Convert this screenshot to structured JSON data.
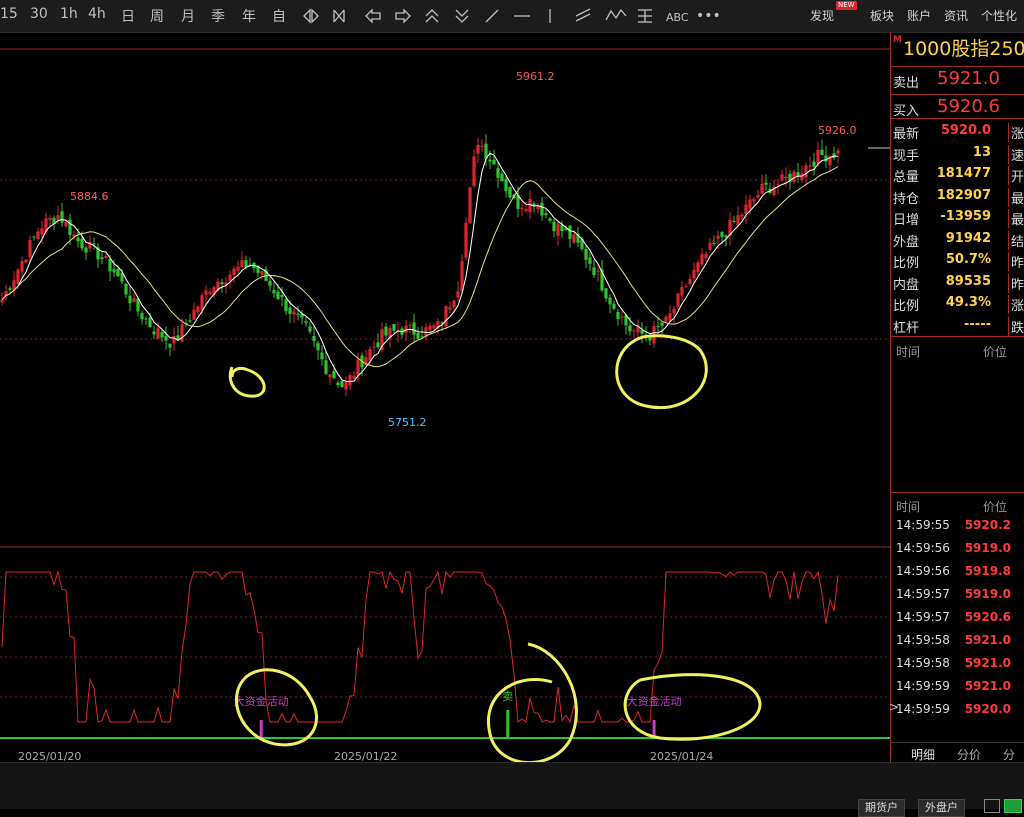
{
  "toolbar": {
    "periods": [
      "15",
      "30",
      "1h",
      "4h",
      "日",
      "周",
      "月",
      "季",
      "年",
      "自"
    ],
    "right_menu": [
      "发现",
      "板块",
      "账户",
      "资讯",
      "个性化"
    ],
    "new_badge": "NEW"
  },
  "contract": {
    "mark": "M",
    "name": "1000股指250"
  },
  "quote": {
    "sell_label": "卖出",
    "sell_value": "5921.0",
    "buy_label": "买入",
    "buy_value": "5920.6",
    "rows": [
      {
        "label": "最新",
        "value": "5920.0",
        "color": "#ff3b3b",
        "extra": "涨跌"
      },
      {
        "label": "现手",
        "value": "13",
        "color": "#ffd24d",
        "extra": "速涨"
      },
      {
        "label": "总量",
        "value": "181477",
        "color": "#ffd24d",
        "extra": "开盘"
      },
      {
        "label": "持仓",
        "value": "182907",
        "color": "#ffd24d",
        "extra": "最高"
      },
      {
        "label": "日增",
        "value": "-13959",
        "color": "#ffd24d",
        "extra": "最低"
      },
      {
        "label": "外盘",
        "value": "91942",
        "color": "#ffd24d",
        "extra": "结算"
      },
      {
        "label": "比例",
        "value": "50.7%",
        "color": "#ffd24d",
        "extra": "昨收"
      },
      {
        "label": "内盘",
        "value": "89535",
        "color": "#ffd24d",
        "extra": "昨结"
      },
      {
        "label": "比例",
        "value": "49.3%",
        "color": "#ffd24d",
        "extra": "涨停"
      },
      {
        "label": "杠杆",
        "value": "-----",
        "color": "#ffd24d",
        "extra": "跌停"
      }
    ]
  },
  "panel_headers": {
    "time": "时间",
    "price": "价位"
  },
  "ticks": [
    {
      "time": "14:59:55",
      "price": "5920.2"
    },
    {
      "time": "14:59:56",
      "price": "5919.0"
    },
    {
      "time": "14:59:56",
      "price": "5919.8"
    },
    {
      "time": "14:59:57",
      "price": "5919.0"
    },
    {
      "time": "14:59:57",
      "price": "5920.6"
    },
    {
      "time": "14:59:58",
      "price": "5921.0"
    },
    {
      "time": "14:59:58",
      "price": "5921.0"
    },
    {
      "time": "14:59:59",
      "price": "5921.0"
    },
    {
      "time": "14:59:59",
      "price": "5920.0"
    }
  ],
  "last_tick_marker": ">",
  "tabs": [
    "明细",
    "分价",
    "分笔"
  ],
  "bottom": {
    "btn1": "期货户",
    "btn2": "外盘户"
  },
  "colors": {
    "up": "#e0232e",
    "down": "#2ec52e",
    "ma_fast": "#ffffff",
    "ma_slow": "#e0e08a",
    "indicator": "#e0232e",
    "annotation": "#f0f060",
    "signal": "#c83cc8",
    "sell_signal": "#2ec52e"
  },
  "chart_data": {
    "type": "candlestick",
    "price_range": [
      5730,
      5975
    ],
    "x_labels": [
      "2025/01/20",
      "2025/01/22",
      "2025/01/24"
    ],
    "price_labels": [
      {
        "text": "5884.6",
        "value": 5884.6,
        "kind": "high"
      },
      {
        "text": "5961.2",
        "value": 5961.2,
        "kind": "high"
      },
      {
        "text": "5751.2",
        "value": 5751.2,
        "kind": "low"
      },
      {
        "text": "5926.0",
        "value": 5926.0,
        "kind": "high"
      }
    ],
    "key_closes": [
      5820,
      5845,
      5870,
      5878,
      5860,
      5852,
      5838,
      5815,
      5800,
      5790,
      5810,
      5830,
      5838,
      5845,
      5832,
      5815,
      5800,
      5775,
      5760,
      5780,
      5795,
      5800,
      5798,
      5802,
      5830,
      5930,
      5910,
      5885,
      5888,
      5872,
      5862,
      5845,
      5820,
      5800,
      5795,
      5805,
      5830,
      5850,
      5865,
      5880,
      5895,
      5900,
      5908,
      5918,
      5920
    ],
    "signals": [
      {
        "text": "大资金活动",
        "kind": "big-money"
      },
      {
        "text": "卖",
        "kind": "sell"
      },
      {
        "text": "大资金活动",
        "kind": "big-money"
      }
    ]
  }
}
